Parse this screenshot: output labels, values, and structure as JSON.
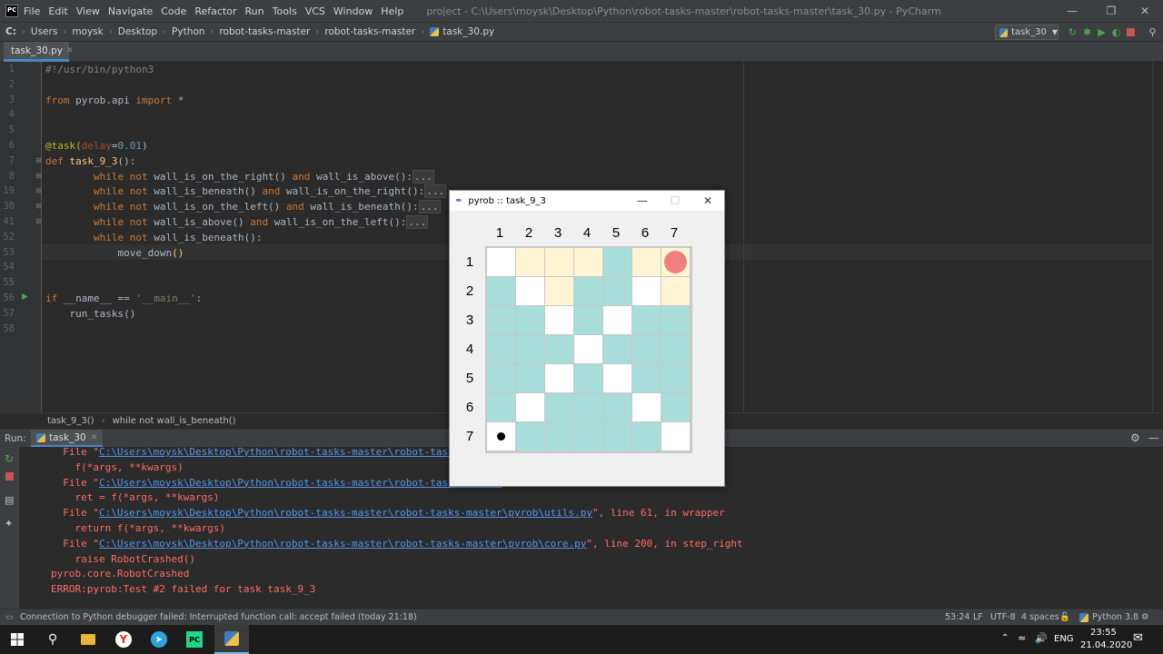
{
  "app": {
    "logo": "PC",
    "menu": [
      "File",
      "Edit",
      "View",
      "Navigate",
      "Code",
      "Refactor",
      "Run",
      "Tools",
      "VCS",
      "Window",
      "Help"
    ],
    "title": "project - C:\\Users\\moysk\\Desktop\\Python\\robot-tasks-master\\robot-tasks-master\\task_30.py - PyCharm"
  },
  "breadcrumbs": [
    "C:",
    "Users",
    "moysk",
    "Desktop",
    "Python",
    "robot-tasks-master",
    "robot-tasks-master",
    "task_30.py"
  ],
  "run_config": "task_30",
  "editor_tab": "task_30.py",
  "editor": {
    "line_numbers": [
      "1",
      "2",
      "3",
      "4",
      "5",
      "6",
      "7",
      "8",
      "19",
      "30",
      "41",
      "52",
      "53",
      "54",
      "55",
      "56",
      "57",
      "58"
    ],
    "lines": [
      [
        {
          "t": "#!/usr/bin/python3",
          "c": "cmt"
        }
      ],
      [],
      [
        {
          "t": "from",
          "c": "kw"
        },
        {
          "t": " pyrob.api "
        },
        {
          "t": "import",
          "c": "kw"
        },
        {
          "t": " *"
        }
      ],
      [],
      [],
      [
        {
          "t": "@task(",
          "c": "dec"
        },
        {
          "t": "delay",
          "c": "par"
        },
        {
          "t": "="
        },
        {
          "t": "0.01",
          "c": "num"
        },
        {
          "t": ")"
        }
      ],
      [
        {
          "t": "def",
          "c": "kw"
        },
        {
          "t": " "
        },
        {
          "t": "task_9_3",
          "c": "fn"
        },
        {
          "t": "():"
        }
      ],
      [
        {
          "t": "        "
        },
        {
          "t": "while",
          "c": "kw"
        },
        {
          "t": " "
        },
        {
          "t": "not",
          "c": "kw"
        },
        {
          "t": " wall_is_on_the_right() "
        },
        {
          "t": "and",
          "c": "kw"
        },
        {
          "t": " wall_is_above():"
        },
        {
          "t": "...",
          "c": "fold"
        }
      ],
      [
        {
          "t": "        "
        },
        {
          "t": "while",
          "c": "kw"
        },
        {
          "t": " "
        },
        {
          "t": "not",
          "c": "kw"
        },
        {
          "t": " wall_is_beneath() "
        },
        {
          "t": "and",
          "c": "kw"
        },
        {
          "t": " wall_is_on_the_right():"
        },
        {
          "t": "...",
          "c": "fold"
        }
      ],
      [
        {
          "t": "        "
        },
        {
          "t": "while",
          "c": "kw"
        },
        {
          "t": " "
        },
        {
          "t": "not",
          "c": "kw"
        },
        {
          "t": " wall_is_on_the_left() "
        },
        {
          "t": "and",
          "c": "kw"
        },
        {
          "t": " wall_is_beneath():"
        },
        {
          "t": "...",
          "c": "fold"
        }
      ],
      [
        {
          "t": "        "
        },
        {
          "t": "while",
          "c": "kw"
        },
        {
          "t": " "
        },
        {
          "t": "not",
          "c": "kw"
        },
        {
          "t": " wall_is_above() "
        },
        {
          "t": "and",
          "c": "kw"
        },
        {
          "t": " wall_is_on_the_left():"
        },
        {
          "t": "...",
          "c": "fold"
        }
      ],
      [
        {
          "t": "        "
        },
        {
          "t": "while",
          "c": "kw"
        },
        {
          "t": " "
        },
        {
          "t": "not",
          "c": "kw"
        },
        {
          "t": " wall_is_beneath():"
        }
      ],
      [
        {
          "t": "            move_down"
        },
        {
          "t": "()",
          "c": "fn"
        }
      ],
      [],
      [],
      [
        {
          "t": "if",
          "c": "kw"
        },
        {
          "t": " __name__ == "
        },
        {
          "t": "'__main__'",
          "c": "str"
        },
        {
          "t": ":"
        }
      ],
      [
        {
          "t": "    run_tasks()"
        }
      ],
      []
    ]
  },
  "editor_breadcrumb": [
    "task_9_3()",
    "while not wall_is_beneath()"
  ],
  "run_panel": {
    "label": "Run:",
    "tab": "task_30",
    "output": [
      [
        {
          "t": "  File \""
        },
        {
          "t": "C:\\Users\\moysk\\Desktop\\Python\\robot-tasks-master\\robot-tasks-master",
          "l": true
        }
      ],
      [
        {
          "t": "    f(*args, **kwargs)"
        }
      ],
      [
        {
          "t": "  File \""
        },
        {
          "t": "C:\\Users\\moysk\\Desktop\\Python\\robot-tasks-master\\robot-tasks-master",
          "l": true
        }
      ],
      [
        {
          "t": "    ret = f(*args, **kwargs)"
        }
      ],
      [
        {
          "t": "  File \""
        },
        {
          "t": "C:\\Users\\moysk\\Desktop\\Python\\robot-tasks-master\\robot-tasks-master\\pyrob\\utils.py",
          "l": true
        },
        {
          "t": "\", line 61, in wrapper"
        }
      ],
      [
        {
          "t": "    return f(*args, **kwargs)"
        }
      ],
      [
        {
          "t": "  File \""
        },
        {
          "t": "C:\\Users\\moysk\\Desktop\\Python\\robot-tasks-master\\robot-tasks-master\\pyrob\\core.py",
          "l": true
        },
        {
          "t": "\", line 200, in step_right"
        }
      ],
      [
        {
          "t": "    raise RobotCrashed()"
        }
      ],
      [
        {
          "t": "pyrob.core.RobotCrashed"
        }
      ],
      [
        {
          "t": "ERROR:pyrob:Test #2 failed for task task_9_3"
        }
      ]
    ]
  },
  "status": {
    "message": "Connection to Python debugger failed: Interrupted function call: accept failed (today 21:18)",
    "position": "53:24",
    "line_sep": "LF",
    "encoding": "UTF-8",
    "indent": "4 spaces",
    "interpreter": "Python 3.8"
  },
  "taskbar": {
    "lang": "ENG",
    "time": "23:55",
    "date": "21.04.2020"
  },
  "tk_window": {
    "title": "pyrob :: task_9_3",
    "col_labels": [
      "1",
      "2",
      "3",
      "4",
      "5",
      "6",
      "7"
    ],
    "row_labels": [
      "1",
      "2",
      "3",
      "4",
      "5",
      "6",
      "7"
    ],
    "colors": {
      "w": "#ffffff",
      "y": "#fff5d4",
      "t": "#a8ddd9"
    },
    "cells": [
      [
        "w",
        "y",
        "y",
        "y",
        "t",
        "y",
        "y"
      ],
      [
        "t",
        "w",
        "y",
        "t",
        "t",
        "w",
        "y"
      ],
      [
        "t",
        "t",
        "w",
        "t",
        "w",
        "t",
        "t"
      ],
      [
        "t",
        "t",
        "t",
        "w",
        "t",
        "t",
        "t"
      ],
      [
        "t",
        "t",
        "w",
        "t",
        "w",
        "t",
        "t"
      ],
      [
        "t",
        "w",
        "t",
        "t",
        "t",
        "w",
        "t"
      ],
      [
        "w",
        "t",
        "t",
        "t",
        "t",
        "t",
        "w"
      ]
    ],
    "robot_row": 1,
    "robot_col": 7,
    "robot_color": "#f08080",
    "marker_row": 7,
    "marker_col": 1
  }
}
